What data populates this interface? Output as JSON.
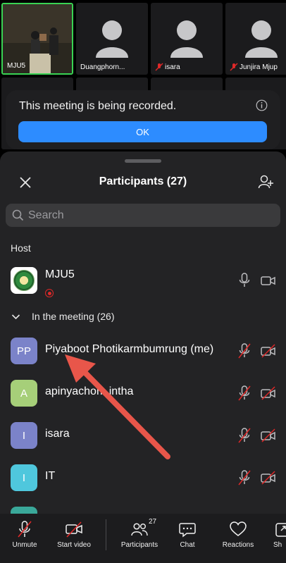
{
  "video_grid": {
    "tiles": [
      {
        "name": "MJU5",
        "muted": false,
        "active": true
      },
      {
        "name": "Duangphorn...",
        "muted": false,
        "active": false
      },
      {
        "name": "isara",
        "muted": true,
        "active": false
      },
      {
        "name": "Junjira Mjup",
        "muted": true,
        "active": false
      }
    ]
  },
  "toast": {
    "message": "This meeting is being recorded.",
    "ok_label": "OK"
  },
  "sheet": {
    "title": "Participants (27)",
    "search_placeholder": "Search",
    "host_section": "Host",
    "meeting_section": "In the meeting (26)",
    "host": {
      "name": "MJU5",
      "recording": true
    },
    "participants": [
      {
        "initials": "PP",
        "name": "Piyaboot Photikarmbumrung (me)",
        "color": "#7b83c9"
      },
      {
        "initials": "A",
        "name": "apinyachom intha",
        "color": "#a6cf79"
      },
      {
        "initials": "I",
        "name": "isara",
        "color": "#7b83c9"
      },
      {
        "initials": "I",
        "name": "IT",
        "color": "#4fc7dd"
      }
    ]
  },
  "toolbar": {
    "unmute": "Unmute",
    "start_video": "Start video",
    "participants": "Participants",
    "participants_count": "27",
    "chat": "Chat",
    "reactions": "Reactions",
    "share": "Sh"
  },
  "colors": {
    "accent": "#2d8cff",
    "muted_red": "#e02828",
    "active_border": "#39d353",
    "annotation_arrow": "#e8564a"
  }
}
